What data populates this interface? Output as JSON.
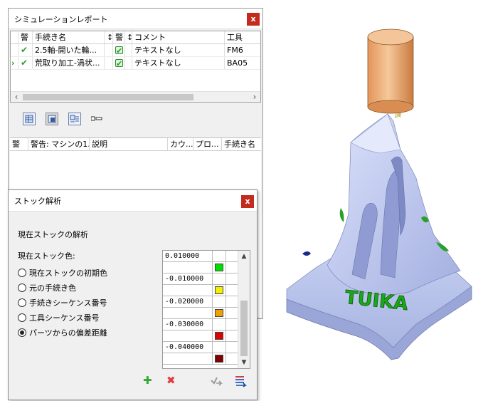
{
  "sim_report": {
    "title": "シミュレーションレポート",
    "close_label": "x",
    "columns": {
      "warn1": "警",
      "name": "手続き名",
      "sort1": "↕",
      "warn2": "警",
      "sort2": "↕",
      "comment": "コメント",
      "tool": "工具"
    },
    "rows": [
      {
        "name": "2.5軸-開いた輪...",
        "comment": "テキストなし",
        "tool": "FM6",
        "current": false
      },
      {
        "name": "荒取り加工-渦状...",
        "comment": "テキストなし",
        "tool": "BA05",
        "current": true
      }
    ],
    "warning_columns": {
      "warn": "警",
      "warning": "警告: マシンの1...",
      "description": "説明",
      "count": "カウ...",
      "program": "プロ...",
      "procedure": "手続き名"
    }
  },
  "stock_analysis": {
    "title": "ストック解析",
    "close_label": "x",
    "subtitle": "現在ストックの解析",
    "color_label": "現在ストック色:",
    "options": [
      {
        "label": "現在ストックの初期色",
        "selected": false
      },
      {
        "label": "元の手続き色",
        "selected": false
      },
      {
        "label": "手続きシーケンス番号",
        "selected": false
      },
      {
        "label": "工具シーケンス番号",
        "selected": false
      },
      {
        "label": "パーツからの偏差距離",
        "selected": true
      }
    ],
    "scale": [
      {
        "value": "0.010000",
        "swatch": null
      },
      {
        "value": "",
        "swatch": "#00e000"
      },
      {
        "value": "-0.010000",
        "swatch": null
      },
      {
        "value": "",
        "swatch": "#f0f000"
      },
      {
        "value": "-0.020000",
        "swatch": null
      },
      {
        "value": "",
        "swatch": "#f0a000"
      },
      {
        "value": "-0.030000",
        "swatch": null
      },
      {
        "value": "",
        "swatch": "#e00000"
      },
      {
        "value": "-0.040000",
        "swatch": null
      },
      {
        "value": "",
        "swatch": "#800000"
      }
    ],
    "buttons": [
      "add-icon",
      "delete-icon",
      "apply-icon",
      "settings-icon"
    ]
  },
  "model_view": {
    "engraved_text": "TUIKA",
    "colors": {
      "stock": "#b8c4ec",
      "tool_holder": "#f0b07c",
      "engrave": "#1aa81a"
    }
  }
}
